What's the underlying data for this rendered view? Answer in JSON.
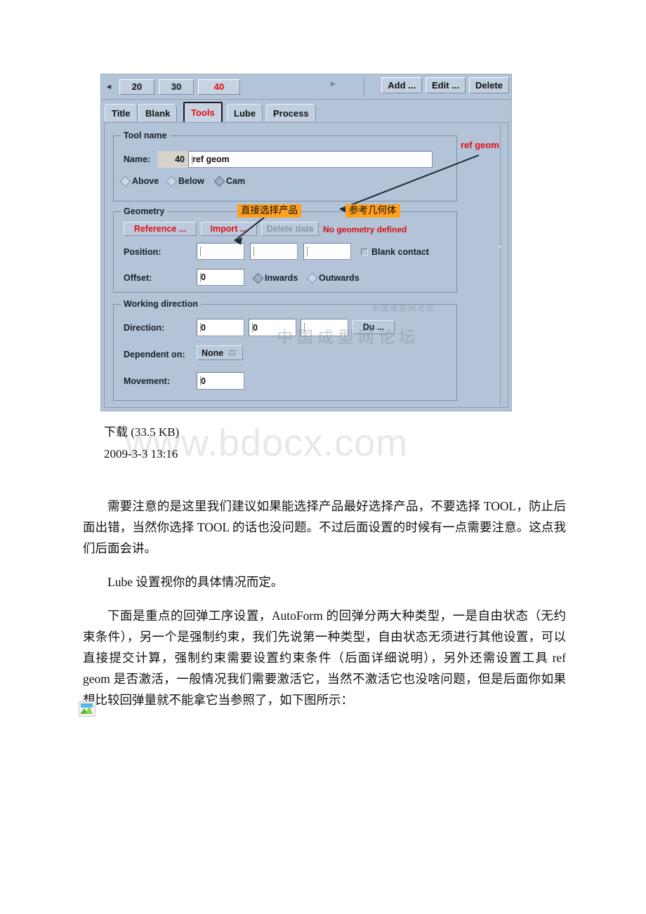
{
  "figure": {
    "toolbar": {
      "prev_icon": "triangle-left-icon",
      "next_icon": "triangle-right-icon",
      "steps": [
        {
          "label": "20",
          "active": false
        },
        {
          "label": "30",
          "active": false
        },
        {
          "label": "40",
          "active": true
        }
      ],
      "actions": [
        {
          "label": "Add ..."
        },
        {
          "label": "Edit ..."
        },
        {
          "label": "Delete"
        }
      ]
    },
    "tabs": [
      {
        "label": "Title",
        "selected": false
      },
      {
        "label": "Blank",
        "selected": false
      },
      {
        "label": "Tools",
        "selected": true
      },
      {
        "label": "Lube",
        "selected": false
      },
      {
        "label": "Process",
        "selected": false
      }
    ],
    "tool_name_group": {
      "legend": "Tool name",
      "name_label": "Name:",
      "name_index": "40",
      "name_value": "ref geom",
      "radios": [
        {
          "label": "Above",
          "selected": false
        },
        {
          "label": "Below",
          "selected": false
        },
        {
          "label": "Cam",
          "selected": true
        }
      ]
    },
    "geometry_group": {
      "legend": "Geometry",
      "reference_button": "Reference ...",
      "import_button": "Import ...",
      "delete_data_button": "Delete data",
      "status_text": "No geometry defined",
      "position_label": "Position:",
      "position_values": [
        "",
        "",
        ""
      ],
      "blank_contact_label": "Blank contact",
      "blank_contact_checked": false,
      "offset_label": "Offset:",
      "offset_value": "0",
      "offset_radios": [
        {
          "label": "Inwards",
          "selected": true
        },
        {
          "label": "Outwards",
          "selected": false
        }
      ]
    },
    "working_direction_group": {
      "legend": "Working direction",
      "direction_label": "Direction:",
      "direction_values": [
        "0",
        "0",
        ""
      ],
      "direction_button": "Du ...",
      "dependent_label": "Dependent on:",
      "dependent_value": "None",
      "movement_label": "Movement:",
      "movement_value": "0"
    },
    "annotations": {
      "callout_select_product": "直接选择产品",
      "callout_ref_geometry": "参考几何体",
      "label_ref_geom": "ref geom"
    },
    "watermarks": {
      "top": "中国成型网论坛",
      "mid": "中国成型网论坛"
    }
  },
  "caption": {
    "download": "下载 (33.5 KB)",
    "timestamp": "2009-3-3 13:16"
  },
  "page_watermark": "www.bdocx.com",
  "body": {
    "paragraphs": [
      "需要注意的是这里我们建议如果能选择产品最好选择产品，不要选择 TOOL，防止后面出错，当然你选择 TOOL 的话也没问题。不过后面设置的时候有一点需要注意。这点我们后面会讲。",
      "Lube 设置视你的具体情况而定。",
      "下面是重点的回弹工序设置，AutoForm 的回弹分两大种类型，一是自由状态（无约束条件），另一个是强制约束，我们先说第一种类型，自由状态无须进行其他设置，可以直接提交计算，强制约束需要设置约束条件（后面详细说明），另外还需设置工具 ref geom 是否激活，一般情况我们需要激活它，当然不激活它也没啥问题，但是后面你如果想比较回弹量就不能拿它当参照了，如下图所示："
    ]
  },
  "broken_image_icon": "broken-image-icon"
}
